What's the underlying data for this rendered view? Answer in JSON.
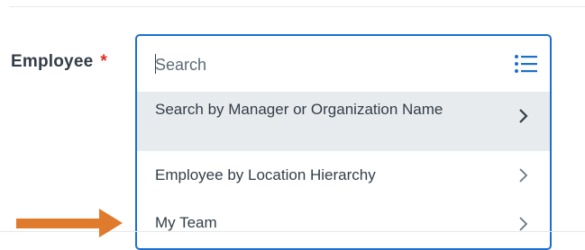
{
  "form": {
    "employee_label": "Employee",
    "required_marker": "*"
  },
  "search": {
    "placeholder": "Search",
    "value": ""
  },
  "menu": {
    "items": [
      {
        "label": "Search by Manager or Organization Name",
        "highlighted": true
      },
      {
        "label": "Employee by Location Hierarchy",
        "highlighted": false
      },
      {
        "label": "My Team",
        "highlighted": false
      }
    ]
  },
  "colors": {
    "accent": "#1b6fcf",
    "required": "#de2e21",
    "highlight_bg": "#e8ebee",
    "annotation_arrow": "#e07a2d"
  },
  "icons": {
    "list": "list-icon",
    "chevron": "chevron-right-icon",
    "annotation": "arrow-right-icon"
  }
}
